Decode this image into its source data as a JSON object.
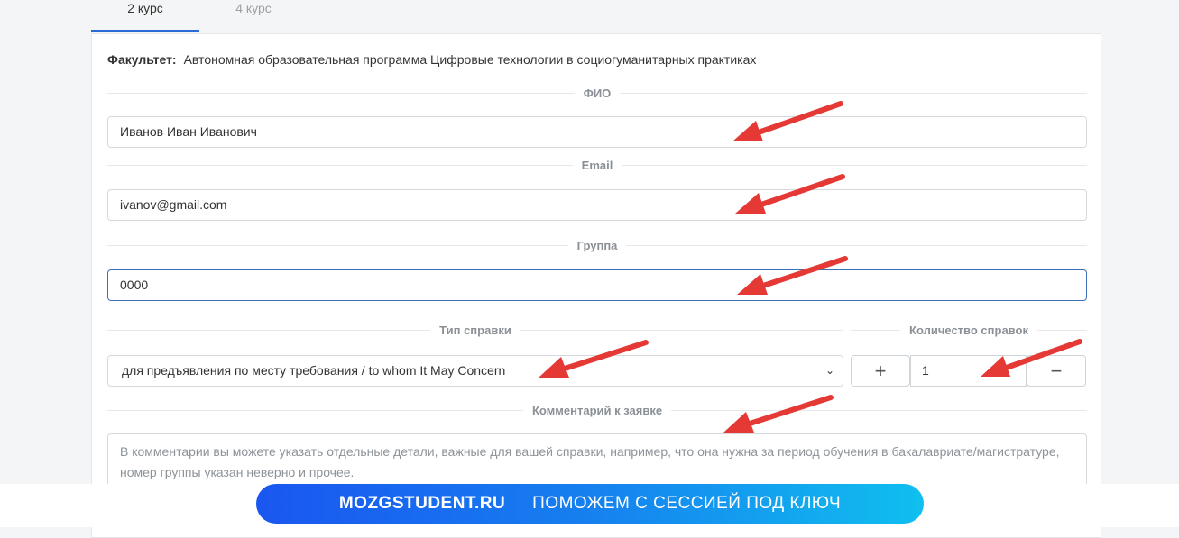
{
  "tabs": [
    {
      "label": "2 курс",
      "active": true
    },
    {
      "label": "4 курс",
      "active": false
    }
  ],
  "faculty": {
    "label": "Факультет:",
    "value": "Автономная образовательная программа Цифровые технологии в социогуманитарных практиках"
  },
  "fio": {
    "legend": "ФИО",
    "value": "Иванов Иван Иванович"
  },
  "email": {
    "legend": "Email",
    "value": "ivanov@gmail.com"
  },
  "group": {
    "legend": "Группа",
    "value": "0000"
  },
  "certificate_type": {
    "legend": "Тип справки",
    "selected": "для предъявления по месту требования / to whom It May Concern"
  },
  "quantity": {
    "legend": "Количество справок",
    "value": "1",
    "plus_label": "+",
    "minus_label": "−"
  },
  "comment": {
    "legend": "Комментарий к заявке",
    "placeholder": "В комментарии вы можете указать отдельные детали, важные для вашей справки, например, что она нужна за период обучения в бакалавриате/магистратуре, номер группы указан неверно и прочее."
  },
  "banner": {
    "brand": "MOZGSTUDENT.RU",
    "slogan": "ПОМОЖЕМ С СЕССИЕЙ ПОД КЛЮЧ"
  },
  "colors": {
    "tab_underline": "#2b6bd6",
    "arrow": "#e53935",
    "banner_start": "#1a56f0",
    "banner_end": "#10bfef"
  },
  "icons": [
    "chevron-down-icon",
    "plus-icon",
    "minus-icon",
    "arrow-pointer-icon"
  ]
}
